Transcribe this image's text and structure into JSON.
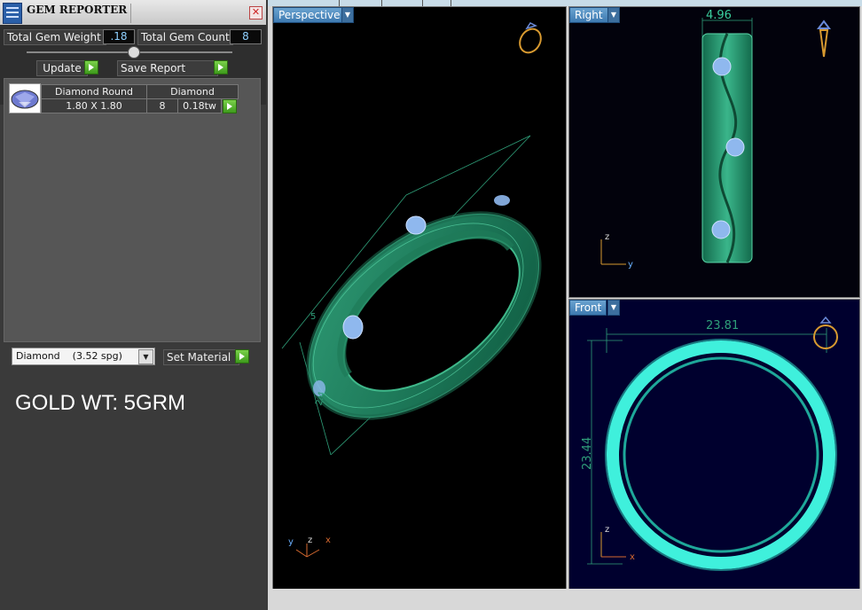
{
  "app": {
    "title": "GEM REPORTER"
  },
  "summary": {
    "weight_label": "Total Gem Weight",
    "weight_value": ".18",
    "count_label": "Total Gem Count",
    "count_value": "8"
  },
  "actions": {
    "update_label": "Update",
    "save_label": "Save Report"
  },
  "gem_table": {
    "headers": [
      "Diamond Round",
      "Diamond"
    ],
    "row": {
      "size": "1.80 X 1.80",
      "count": "8",
      "weight": "0.18tw"
    }
  },
  "material": {
    "selected": "Diamond    (3.52 spg)",
    "set_label": "Set Material"
  },
  "note": "GOLD WT: 5GRM",
  "viewports": {
    "perspective": {
      "label": "Perspective",
      "dims": [
        "5",
        "2.4"
      ],
      "axes": {
        "y": "y",
        "z": "z",
        "x": "x"
      }
    },
    "right": {
      "label": "Right",
      "width_dim": "4.96",
      "axes": {
        "z": "z",
        "y": "y"
      }
    },
    "front": {
      "label": "Front",
      "width_dim": "23.81",
      "height_dim": "23.44",
      "axes": {
        "z": "z",
        "x": "x"
      }
    }
  },
  "colors": {
    "ring": "#1a7a5a",
    "ring_light": "#35b58a",
    "gem": "#8fb8ee",
    "glow": "#3ff0dc",
    "accent": "#3d79b0",
    "go": "#4fb22a"
  }
}
